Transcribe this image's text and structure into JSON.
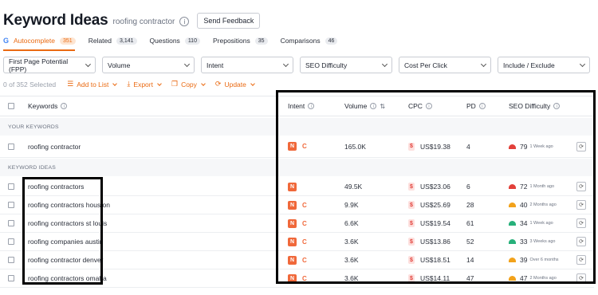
{
  "header": {
    "title": "Keyword Ideas",
    "subtitle": "roofing contractor",
    "info_icon": "info-icon",
    "feedback_label": "Send Feedback"
  },
  "tabs": [
    {
      "label": "Autocomplete",
      "count": "351",
      "active": true,
      "icon": "google-g-icon"
    },
    {
      "label": "Related",
      "count": "3,141"
    },
    {
      "label": "Questions",
      "count": "110"
    },
    {
      "label": "Prepositions",
      "count": "35"
    },
    {
      "label": "Comparisons",
      "count": "46"
    }
  ],
  "filters": {
    "fpp": "First Page Potential (FPP)",
    "volume": "Volume",
    "intent": "Intent",
    "seo_difficulty": "SEO Difficulty",
    "cpc": "Cost Per Click",
    "include_exclude": "Include / Exclude"
  },
  "actions": {
    "selected": "0 of 352 Selected",
    "add_to_list": "Add to List",
    "export": "Export",
    "copy": "Copy",
    "update": "Update"
  },
  "columns": {
    "keywords": "Keywords",
    "intent": "Intent",
    "volume": "Volume",
    "cpc": "CPC",
    "pd": "PD",
    "seo_difficulty": "SEO Difficulty"
  },
  "sections": {
    "your_keywords": "YOUR KEYWORDS",
    "keyword_ideas": "KEYWORD IDEAS"
  },
  "your_keywords": [
    {
      "keyword": "roofing contractor",
      "intent_n": "N",
      "intent_c": "C",
      "volume": "165.0K",
      "cpc_badge": "$",
      "cpc": "US$19.38",
      "pd": "4",
      "kd": "79",
      "kd_date": "1 Week ago",
      "kd_color": "#e2403a"
    }
  ],
  "keyword_ideas": [
    {
      "keyword": "roofing contractors",
      "intent_n": "N",
      "intent_c": "",
      "volume": "49.5K",
      "cpc_badge": "$",
      "cpc": "US$23.06",
      "pd": "6",
      "kd": "72",
      "kd_date": "1 Month ago",
      "kd_color": "#e2403a"
    },
    {
      "keyword": "roofing contractors houston",
      "intent_n": "N",
      "intent_c": "C",
      "volume": "9.9K",
      "cpc_badge": "$",
      "cpc": "US$25.69",
      "pd": "28",
      "kd": "40",
      "kd_date": "2 Months ago",
      "kd_color": "#f2a21b"
    },
    {
      "keyword": "roofing contractors st louis",
      "intent_n": "N",
      "intent_c": "C",
      "volume": "6.6K",
      "cpc_badge": "$",
      "cpc": "US$19.54",
      "pd": "61",
      "kd": "34",
      "kd_date": "1 Week ago",
      "kd_color": "#27b07a"
    },
    {
      "keyword": "roofing companies austin",
      "intent_n": "N",
      "intent_c": "C",
      "volume": "3.6K",
      "cpc_badge": "$",
      "cpc": "US$13.86",
      "pd": "52",
      "kd": "33",
      "kd_date": "3 Weeks ago",
      "kd_color": "#27b07a"
    },
    {
      "keyword": "roofing contractor denver",
      "intent_n": "N",
      "intent_c": "C",
      "volume": "3.6K",
      "cpc_badge": "$",
      "cpc": "US$18.51",
      "pd": "14",
      "kd": "39",
      "kd_date": "Over 6 months",
      "kd_color": "#f2a21b"
    },
    {
      "keyword": "roofing contractors omaha",
      "intent_n": "N",
      "intent_c": "C",
      "volume": "3.6K",
      "cpc_badge": "$",
      "cpc": "US$14.11",
      "pd": "47",
      "kd": "47",
      "kd_date": "2 Months ago",
      "kd_color": "#f2a21b"
    }
  ],
  "colors": {
    "accent": "#ea6a12",
    "intent_badge": "#f0683a",
    "highlight_border": "#000000"
  }
}
